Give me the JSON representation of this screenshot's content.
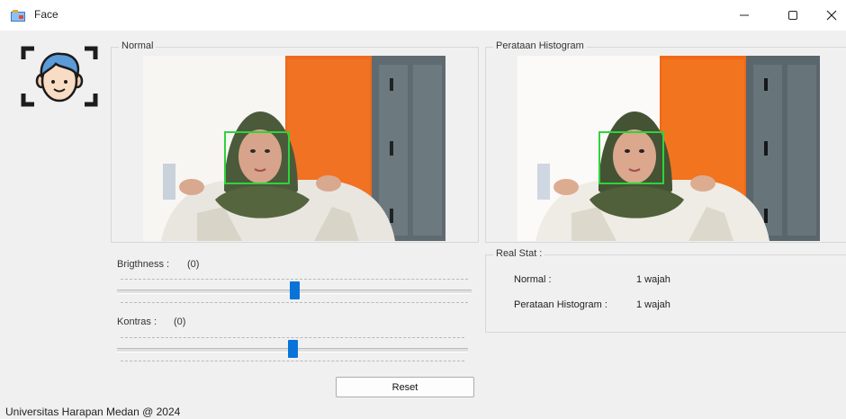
{
  "window": {
    "title": "Face"
  },
  "panels": {
    "normal": {
      "title": "Normal"
    },
    "equalized": {
      "title": "Perataan Histogram"
    },
    "realstat": {
      "title": "Real Stat :"
    }
  },
  "controls": {
    "brightness": {
      "label": "Brigthness :",
      "value": "(0)",
      "level": 0.5
    },
    "contrast": {
      "label": "Kontras :",
      "value": "(0)",
      "level": 0.5
    },
    "reset_label": "Reset"
  },
  "stats": [
    {
      "label": "Normal :",
      "value": "1 wajah"
    },
    {
      "label": "Perataan Histogram :",
      "value": "1 wajah"
    }
  ],
  "statusbar": {
    "text": "Universitas Harapan Medan @ 2024"
  },
  "colors": {
    "accent": "#0a73d9",
    "face_box": "#2fd33a",
    "door_orange": "#ee6a1c",
    "locker_gray": "#5f6b70",
    "hijab": "#4b5a3b"
  },
  "icons": {
    "app": "face-app-icon",
    "minimize": "minimize-icon",
    "maximize": "maximize-icon",
    "close": "close-icon",
    "logo": "face-scan-logo-icon"
  }
}
